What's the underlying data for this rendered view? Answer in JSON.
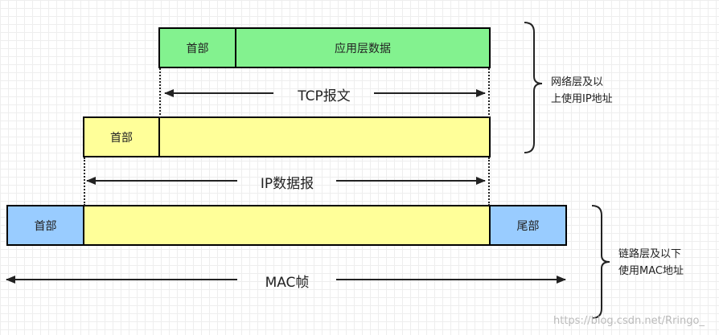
{
  "tcp_segment": {
    "header_label": "首部",
    "data_label": "应用层数据",
    "caption": "TCP报文"
  },
  "ip_datagram": {
    "header_label": "首部",
    "caption": "IP数据报"
  },
  "mac_frame": {
    "header_label": "首部",
    "trailer_label": "尾部",
    "caption": "MAC帧"
  },
  "side_notes": {
    "upper": [
      "网络层及以",
      "上使用IP地址"
    ],
    "lower": [
      "链路层及以下",
      "使用MAC地址"
    ]
  },
  "watermark": "https://blog.csdn.net/Rringo_",
  "colors": {
    "tcp_fill": "#83f28f",
    "ip_fill": "#ffff99",
    "mac_edge_fill": "#99ccff"
  }
}
